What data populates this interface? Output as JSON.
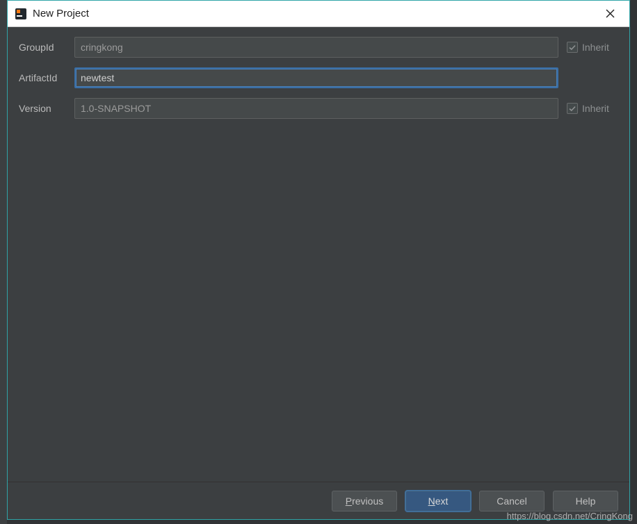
{
  "title": "New Project",
  "fields": {
    "groupId": {
      "label": "GroupId",
      "value": "cringkong",
      "inherit": "Inherit"
    },
    "artifactId": {
      "label": "ArtifactId",
      "value": "newtest"
    },
    "version": {
      "label": "Version",
      "value": "1.0-SNAPSHOT",
      "inherit": "Inherit"
    }
  },
  "buttons": {
    "previous_prefix": "P",
    "previous_rest": "revious",
    "next_prefix": "N",
    "next_rest": "ext",
    "cancel": "Cancel",
    "help": "Help"
  },
  "watermark": "https://blog.csdn.net/CringKong"
}
